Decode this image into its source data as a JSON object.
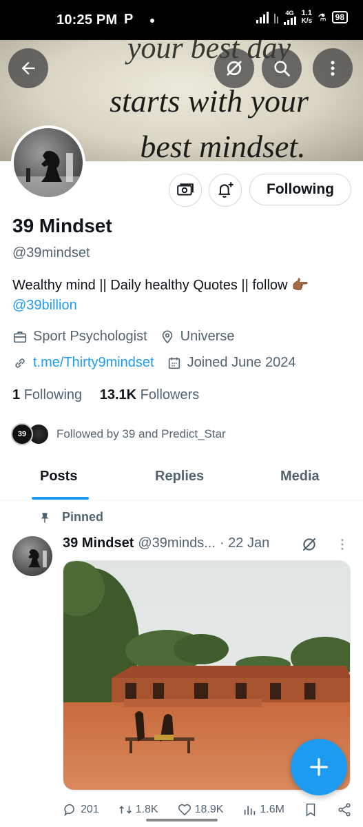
{
  "status_bar": {
    "time": "10:25 PM",
    "app_indicator": "P",
    "network_type": "4G",
    "speed_value": "1.1",
    "speed_unit": "K/s",
    "battery": "98"
  },
  "banner": {
    "line1": "your best day",
    "line2": "starts with your",
    "line3": "best mindset."
  },
  "profile": {
    "name": "39 Mindset",
    "handle": "@39mindset",
    "bio_text": "Wealthy mind || Daily healthy Quotes || follow 👉🏾",
    "bio_mention": "@39billion",
    "category": "Sport Psychologist",
    "location": "Universe",
    "link": "t.me/Thirty9mindset",
    "joined": "Joined June 2024",
    "following_count": "1",
    "following_label": "Following",
    "followers_count": "13.1K",
    "followers_label": "Followers",
    "followed_by_text": "Followed by 39 and Predict_Star",
    "followed_by_avatar_label": "39"
  },
  "buttons": {
    "following": "Following"
  },
  "tabs": [
    {
      "label": "Posts",
      "active": true
    },
    {
      "label": "Replies",
      "active": false
    },
    {
      "label": "Media",
      "active": false
    }
  ],
  "post": {
    "pinned_label": "Pinned",
    "author_name": "39 Mindset",
    "author_handle": "@39minds...",
    "date": "· 22 Jan",
    "actions": {
      "replies": "201",
      "reposts": "1.8K",
      "likes": "18.9K",
      "views": "1.6M"
    }
  },
  "colors": {
    "accent": "#1d9bf0",
    "text_primary": "#0f1419",
    "text_secondary": "#536471"
  }
}
